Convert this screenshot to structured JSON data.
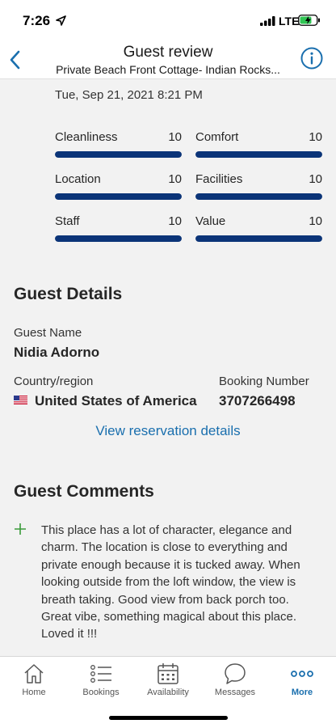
{
  "status_bar": {
    "time": "7:26",
    "network": "LTE"
  },
  "header": {
    "title": "Guest review",
    "subtitle": "Private Beach Front Cottage- Indian Rocks..."
  },
  "review": {
    "date": "Tue, Sep 21, 2021 8:21 PM",
    "max_score": 10,
    "bar_color": "#0b3478",
    "scores": [
      {
        "label": "Cleanliness",
        "value": "10",
        "fill_fraction": 1.0
      },
      {
        "label": "Comfort",
        "value": "10",
        "fill_fraction": 1.0
      },
      {
        "label": "Location",
        "value": "10",
        "fill_fraction": 1.0
      },
      {
        "label": "Facilities",
        "value": "10",
        "fill_fraction": 1.0
      },
      {
        "label": "Staff",
        "value": "10",
        "fill_fraction": 1.0
      },
      {
        "label": "Value",
        "value": "10",
        "fill_fraction": 1.0
      }
    ]
  },
  "guest_details": {
    "title": "Guest Details",
    "name_label": "Guest Name",
    "name": "Nidia Adorno",
    "country_label": "Country/region",
    "country": "United States of America",
    "country_flag_icon": "us-flag-icon",
    "booking_label": "Booking Number",
    "booking_number": "3707266498",
    "view_link": "View reservation details"
  },
  "guest_comments": {
    "title": "Guest Comments",
    "comment_icon": "plus-icon",
    "positive": "This place has a lot of character, elegance and charm. The location is close to everything and private enough because it is tucked away. When looking outside from the loft window, the view is breath taking. Good view from back porch too. Great vibe, something magical about this place. Loved it !!!"
  },
  "tab_bar": {
    "accent_color": "#1a6fae",
    "tabs": [
      {
        "label": "Home",
        "icon": "home-icon",
        "active": false
      },
      {
        "label": "Bookings",
        "icon": "list-icon",
        "active": false
      },
      {
        "label": "Availability",
        "icon": "calendar-icon",
        "active": false
      },
      {
        "label": "Messages",
        "icon": "chat-bubble-icon",
        "active": false
      },
      {
        "label": "More",
        "icon": "more-dots-icon",
        "active": true
      }
    ]
  }
}
